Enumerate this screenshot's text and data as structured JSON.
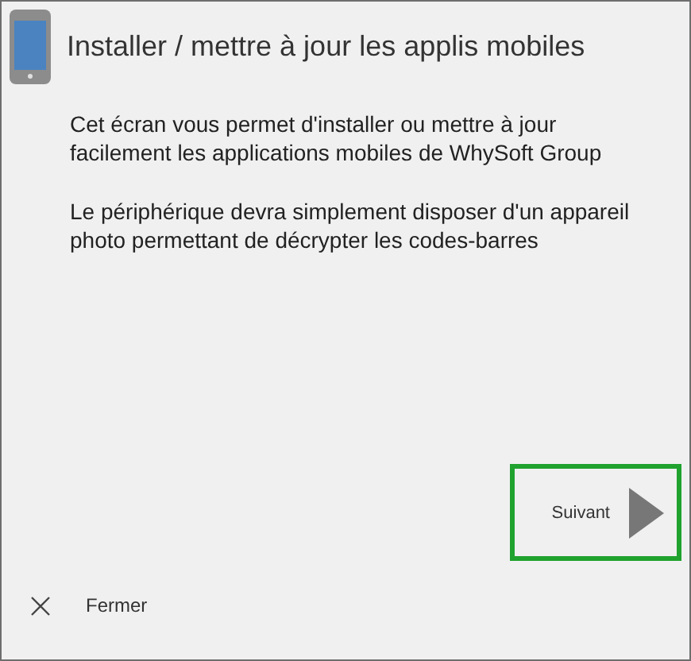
{
  "header": {
    "title": "Installer / mettre à jour les applis mobiles"
  },
  "paragraphs": [
    "Cet écran vous permet d'installer ou mettre à jour facilement les applications mobiles de WhySoft Group",
    "Le périphérique devra simplement disposer d'un appareil photo permettant de décrypter les codes-barres"
  ],
  "next_button": {
    "label": "Suivant",
    "focused": true
  },
  "close_button": {
    "label": "Fermer"
  }
}
